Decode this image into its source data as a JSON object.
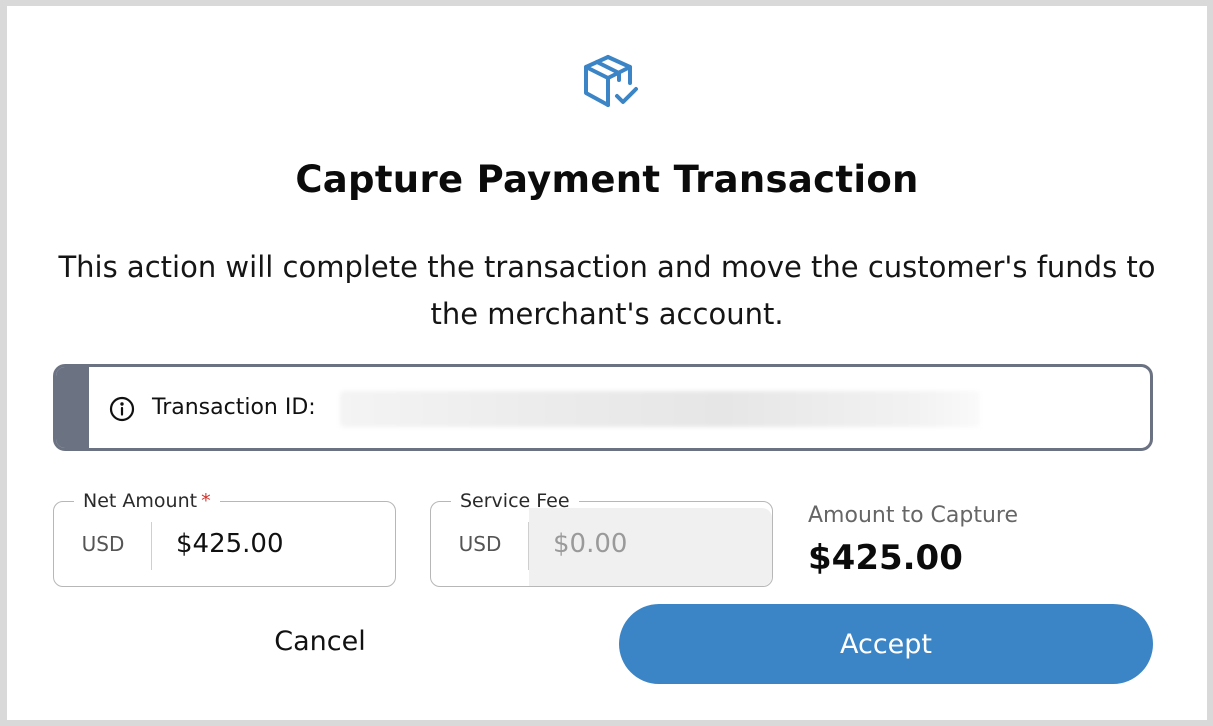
{
  "dialog": {
    "icon": "package-check-icon",
    "title": "Capture Payment Transaction",
    "description": "This action will complete the transaction and move the customer's funds to the merchant's account."
  },
  "info": {
    "icon": "info-icon",
    "label": "Transaction ID:"
  },
  "fields": {
    "net_amount": {
      "label": "Net Amount",
      "required_marker": "*",
      "currency": "USD",
      "value": "$425.00"
    },
    "service_fee": {
      "label": "Service Fee",
      "currency": "USD",
      "placeholder": "$0.00"
    }
  },
  "summary": {
    "label": "Amount to Capture",
    "value": "$425.00"
  },
  "actions": {
    "cancel_label": "Cancel",
    "accept_label": "Accept"
  },
  "colors": {
    "accent": "#3b85c6",
    "info_stripe": "#6b7282",
    "required": "#d0342c"
  }
}
